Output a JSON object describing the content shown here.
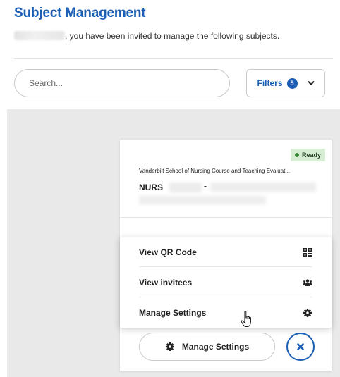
{
  "page": {
    "title": "Subject Management",
    "subtitle": ", you have been invited to manage the following subjects."
  },
  "search": {
    "placeholder": "Search..."
  },
  "filters": {
    "label": "Filters",
    "count": "5"
  },
  "card": {
    "status": "Ready",
    "course_title": "Vanderbilt School of Nursing Course and Teaching Evaluat...",
    "course_code_prefix": "NURS",
    "course_code_separator": "-"
  },
  "menu": {
    "items": [
      {
        "label": "View QR Code",
        "icon": "qr-code-icon"
      },
      {
        "label": "View invitees",
        "icon": "users-icon"
      },
      {
        "label": "Manage Settings",
        "icon": "gear-icon"
      }
    ]
  },
  "footer": {
    "manage_label": "Manage Settings",
    "close_icon": "close-icon"
  },
  "colors": {
    "accent": "#1a5fb4",
    "ready_bg": "#d6ecd3",
    "ready_dot": "#3a8a3a",
    "panel_grey": "#e9e9ea"
  }
}
